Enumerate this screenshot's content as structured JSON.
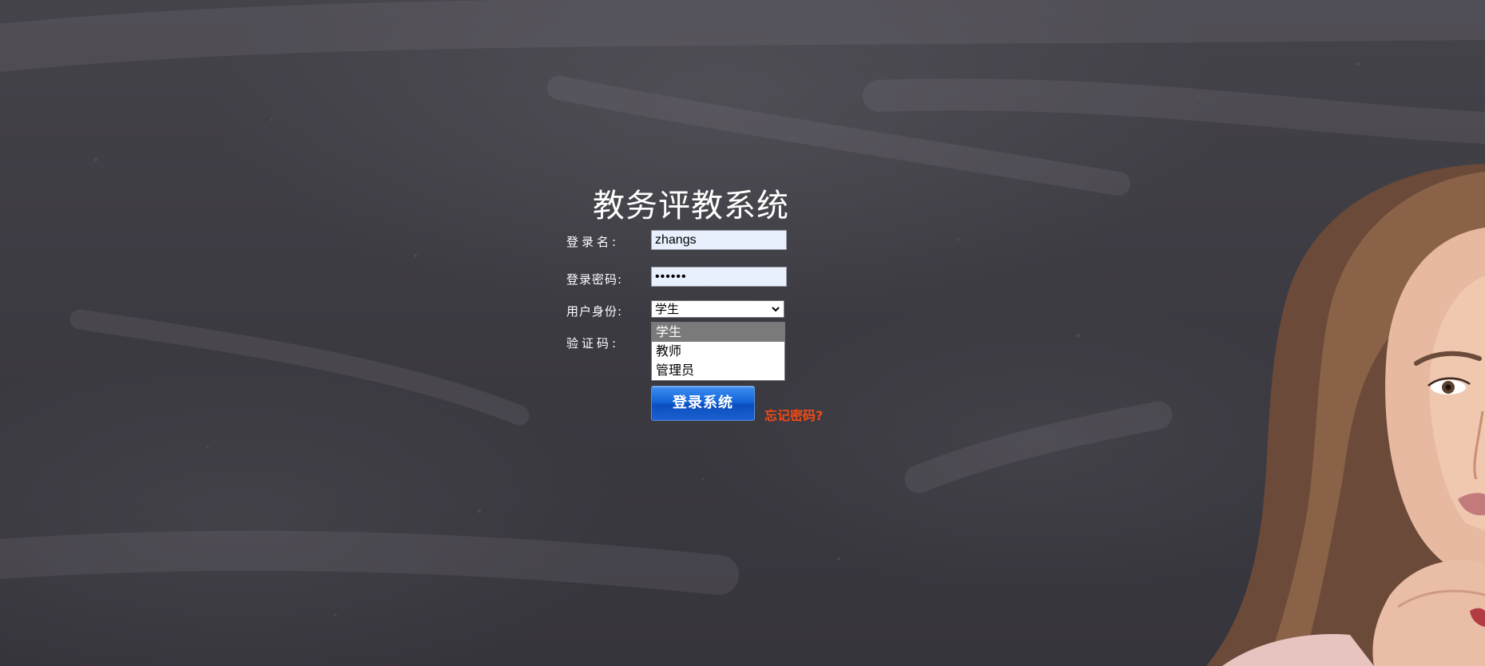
{
  "title": "教务评教系统",
  "form": {
    "username_label": "登录名:",
    "username_value": "zhangs",
    "password_label": "登录密码:",
    "password_value": "••••••",
    "role_label": "用户身份:",
    "role_selected": "学生",
    "role_options": [
      "学生",
      "教师",
      "管理员"
    ],
    "captcha_label": "验证码:"
  },
  "buttons": {
    "login_label": "登录系统",
    "forgot_label": "忘记密码?"
  },
  "colors": {
    "background": "#3e3c43",
    "title": "#ffffff",
    "login_button": "#1566d8",
    "forgot_link": "#f04a18",
    "selected_option": "#7a7a7a"
  },
  "icons": {
    "select_arrow": "chevron-down-icon"
  }
}
